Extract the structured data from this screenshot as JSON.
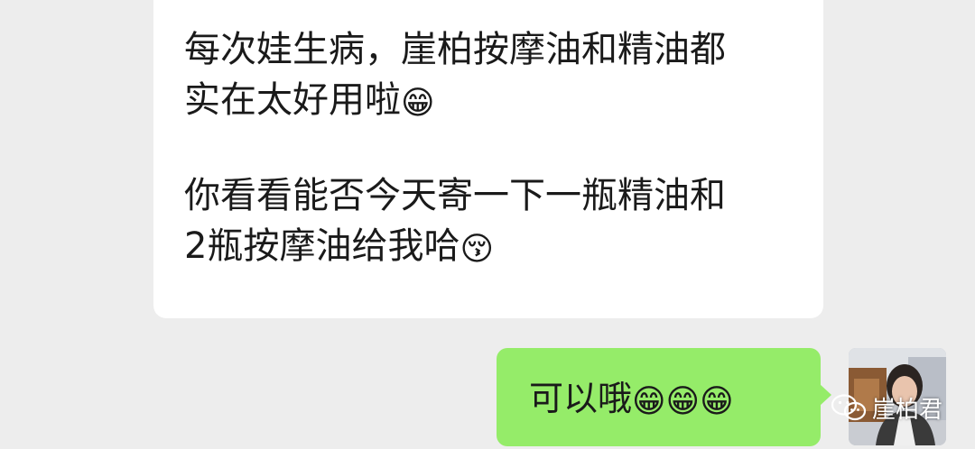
{
  "incoming": {
    "line1": "每次娃生病，崖柏按摩油和精油都",
    "line2": "实在太好用啦",
    "line3": "你看看能否今天寄一下一瓶精油和",
    "line4": "2瓶按摩油给我哈",
    "emoji_grin": "😁",
    "emoji_kiss": "😚"
  },
  "outgoing": {
    "text": "可以哦",
    "emoji": "😁"
  },
  "watermark": {
    "label": "崖柏君",
    "icon": "wechat-icon"
  },
  "colors": {
    "background": "#ededed",
    "incoming_bubble": "#ffffff",
    "outgoing_bubble": "#95ec69",
    "text": "#1a1a1a"
  }
}
